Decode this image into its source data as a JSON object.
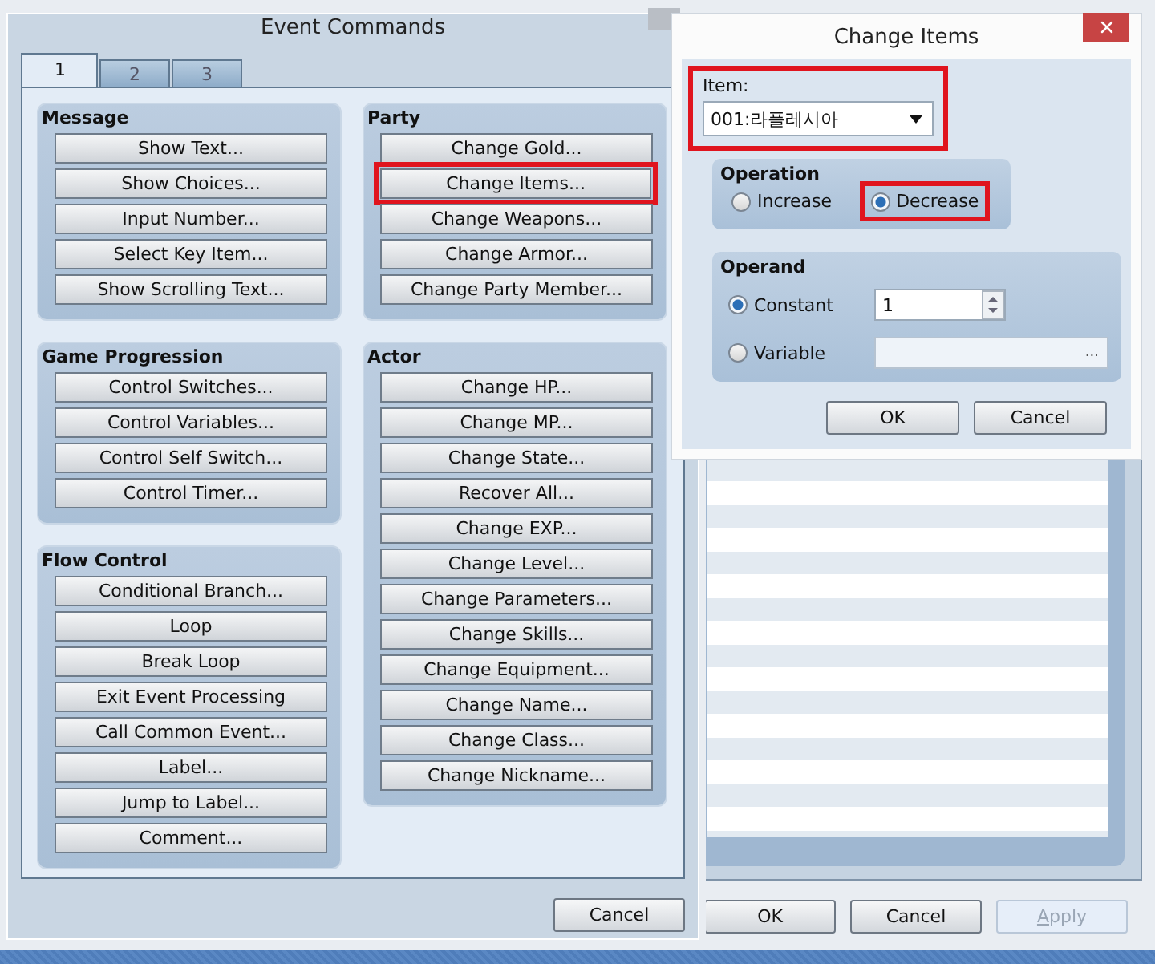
{
  "back_window": {
    "buttons": [
      {
        "label": "OK",
        "disabled": false
      },
      {
        "label": "Cancel",
        "disabled": false
      },
      {
        "label": "Apply",
        "disabled": true
      }
    ]
  },
  "event_commands": {
    "title": "Event Commands",
    "tabs": [
      {
        "label": "1",
        "selected": true
      },
      {
        "label": "2",
        "selected": false
      },
      {
        "label": "3",
        "selected": false
      }
    ],
    "columns": [
      [
        {
          "title": "Message",
          "commands": [
            {
              "label": "Show Text...",
              "highlighted": false
            },
            {
              "label": "Show Choices...",
              "highlighted": false
            },
            {
              "label": "Input Number...",
              "highlighted": false
            },
            {
              "label": "Select Key Item...",
              "highlighted": false
            },
            {
              "label": "Show Scrolling Text...",
              "highlighted": false
            }
          ]
        },
        {
          "title": "Game Progression",
          "commands": [
            {
              "label": "Control Switches...",
              "highlighted": false
            },
            {
              "label": "Control Variables...",
              "highlighted": false
            },
            {
              "label": "Control Self Switch...",
              "highlighted": false
            },
            {
              "label": "Control Timer...",
              "highlighted": false
            }
          ]
        },
        {
          "title": "Flow Control",
          "commands": [
            {
              "label": "Conditional Branch...",
              "highlighted": false
            },
            {
              "label": "Loop",
              "highlighted": false
            },
            {
              "label": "Break Loop",
              "highlighted": false
            },
            {
              "label": "Exit Event Processing",
              "highlighted": false
            },
            {
              "label": "Call Common Event...",
              "highlighted": false
            },
            {
              "label": "Label...",
              "highlighted": false
            },
            {
              "label": "Jump to Label...",
              "highlighted": false
            },
            {
              "label": "Comment...",
              "highlighted": false
            }
          ]
        }
      ],
      [
        {
          "title": "Party",
          "commands": [
            {
              "label": "Change Gold...",
              "highlighted": false
            },
            {
              "label": "Change Items...",
              "highlighted": true
            },
            {
              "label": "Change Weapons...",
              "highlighted": false
            },
            {
              "label": "Change Armor...",
              "highlighted": false
            },
            {
              "label": "Change Party Member...",
              "highlighted": false
            }
          ]
        },
        {
          "title": "Actor",
          "commands": [
            {
              "label": "Change HP...",
              "highlighted": false
            },
            {
              "label": "Change MP...",
              "highlighted": false
            },
            {
              "label": "Change State...",
              "highlighted": false
            },
            {
              "label": "Recover All...",
              "highlighted": false
            },
            {
              "label": "Change EXP...",
              "highlighted": false
            },
            {
              "label": "Change Level...",
              "highlighted": false
            },
            {
              "label": "Change Parameters...",
              "highlighted": false
            },
            {
              "label": "Change Skills...",
              "highlighted": false
            },
            {
              "label": "Change Equipment...",
              "highlighted": false
            },
            {
              "label": "Change Name...",
              "highlighted": false
            },
            {
              "label": "Change Class...",
              "highlighted": false
            },
            {
              "label": "Change Nickname...",
              "highlighted": false
            }
          ]
        }
      ]
    ],
    "cancel": "Cancel"
  },
  "change_items": {
    "title": "Change Items",
    "item": {
      "label": "Item:",
      "value": "001:라플레시아",
      "highlighted": true
    },
    "operation": {
      "title": "Operation",
      "options": [
        {
          "label": "Increase",
          "selected": false,
          "highlighted": false
        },
        {
          "label": "Decrease",
          "selected": true,
          "highlighted": true
        }
      ]
    },
    "operand": {
      "title": "Operand",
      "options": [
        {
          "label": "Constant",
          "selected": true,
          "kind": "spin",
          "value": "1"
        },
        {
          "label": "Variable",
          "selected": false,
          "kind": "picker",
          "browse": "..."
        }
      ]
    },
    "buttons": [
      "OK",
      "Cancel"
    ]
  }
}
